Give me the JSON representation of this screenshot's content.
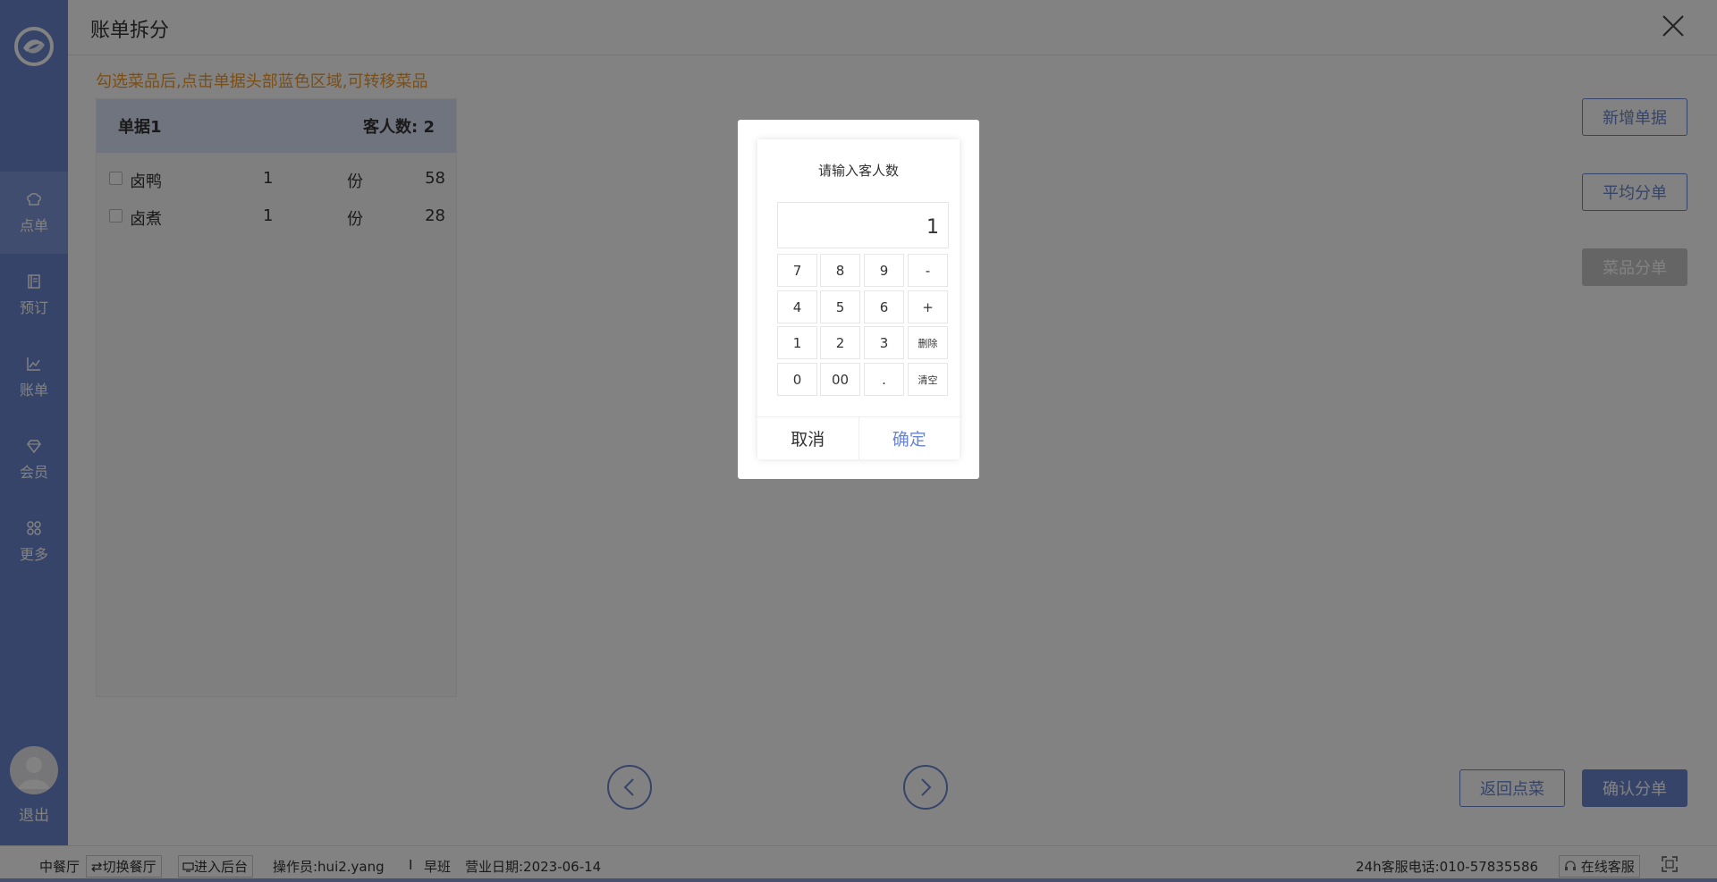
{
  "sidebar": {
    "items": [
      {
        "label": "点单",
        "icon": "chef-hat-icon",
        "active": true
      },
      {
        "label": "预订",
        "icon": "book-icon",
        "active": false
      },
      {
        "label": "账单",
        "icon": "chart-icon",
        "active": false
      },
      {
        "label": "会员",
        "icon": "diamond-icon",
        "active": false
      },
      {
        "label": "更多",
        "icon": "grid-icon",
        "active": false
      }
    ],
    "logout": "退出"
  },
  "header": {
    "title": "账单拆分"
  },
  "hint": "勾选菜品后,点击单据头部蓝色区域,可转移菜品",
  "bill": {
    "name": "单据1",
    "guests_label": "客人数:",
    "guests": "2",
    "items": [
      {
        "name": "卤鸭",
        "qty": "1",
        "unit": "份",
        "price": "58"
      },
      {
        "name": "卤煮",
        "qty": "1",
        "unit": "份",
        "price": "28"
      }
    ]
  },
  "buttons": {
    "add_bill": "新增单据",
    "average_split": "平均分单",
    "dish_split": "菜品分单",
    "back_to_order": "返回点菜",
    "confirm_split": "确认分单"
  },
  "footer": {
    "restaurant": "中餐厅",
    "switch_restaurant": "⇄切换餐厅",
    "enter_backend": "进入后台",
    "operator": "操作员:hui2.yang",
    "separator": "I",
    "shift": "早班",
    "business_date": "营业日期:2023-06-14",
    "hotline": "24h客服电话:010-57835586",
    "online_service": "在线客服"
  },
  "dialog": {
    "title": "请输入客人数",
    "value": "1",
    "keys": [
      [
        "7",
        "8",
        "9",
        "-"
      ],
      [
        "4",
        "5",
        "6",
        "+"
      ],
      [
        "1",
        "2",
        "3",
        "删除"
      ],
      [
        "0",
        "00",
        ".",
        "清空"
      ]
    ],
    "cancel": "取消",
    "confirm": "确定"
  },
  "colors": {
    "brand": "#6b86cf",
    "hint": "#f19a2a",
    "overlay": "rgba(0,0,0,0.49)"
  }
}
